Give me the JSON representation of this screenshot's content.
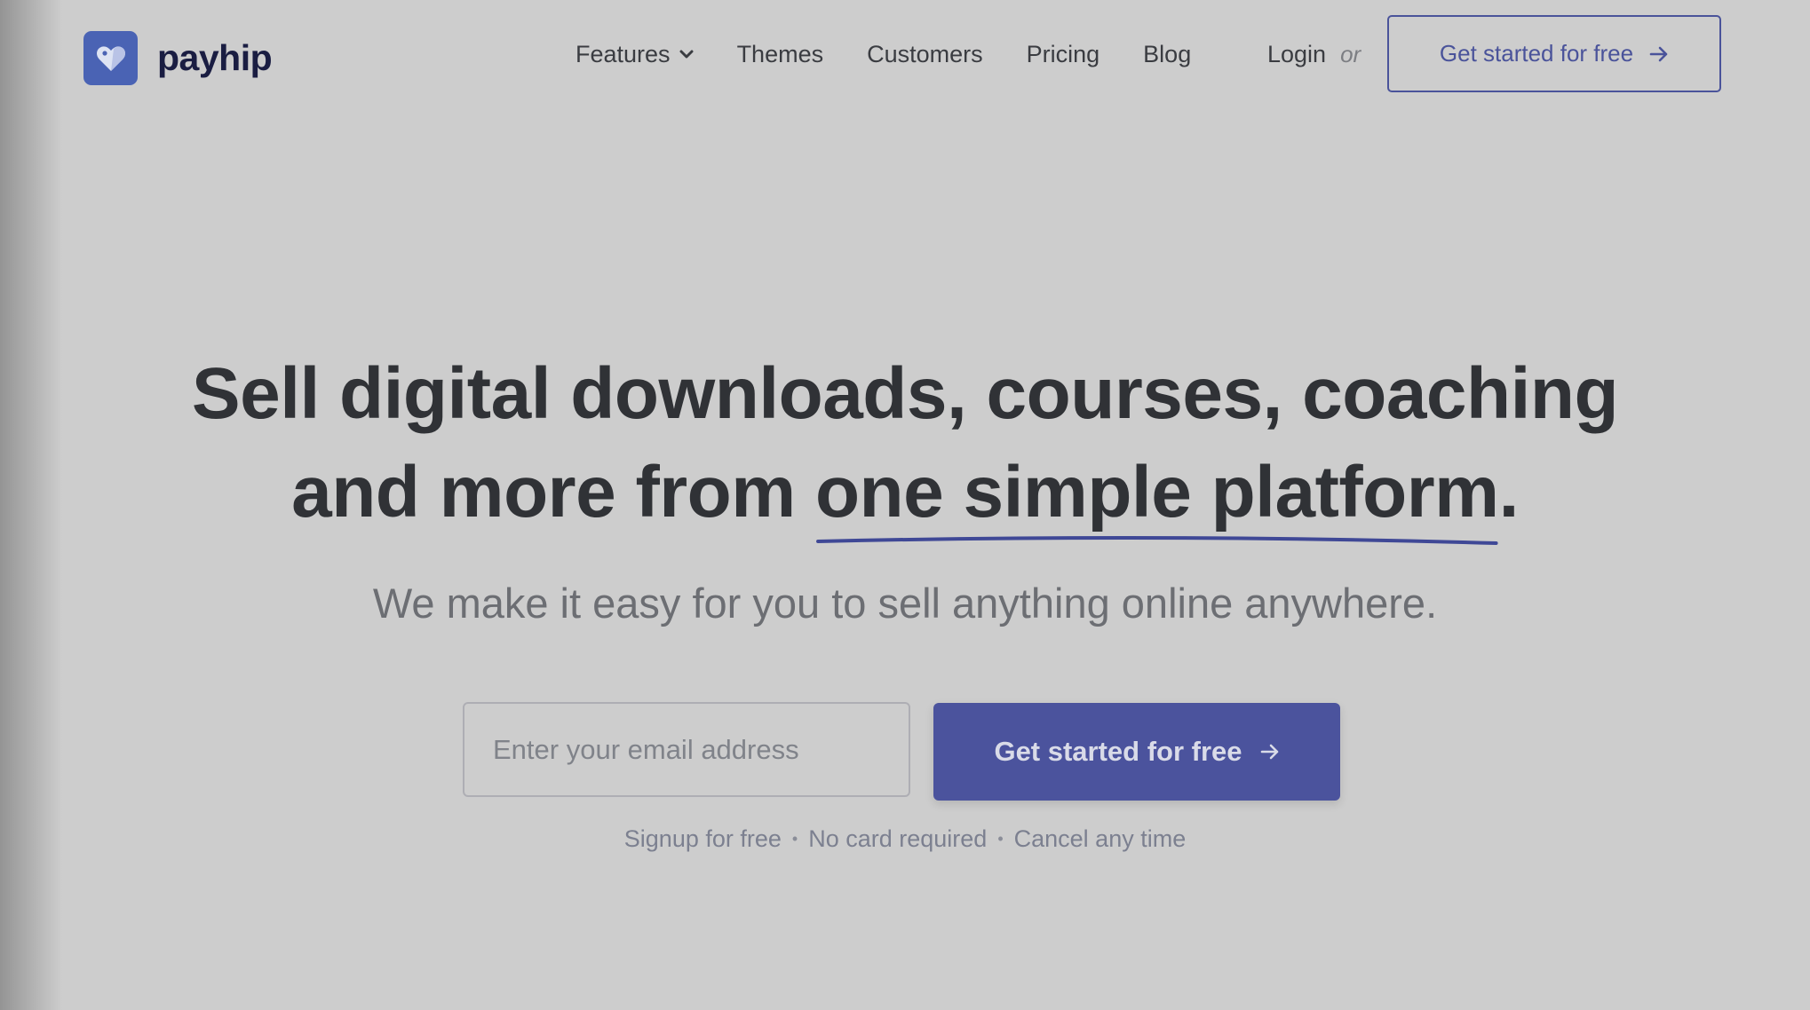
{
  "brand": {
    "name": "payhip",
    "icon": "heart-tag-icon",
    "accent": "#4b539d"
  },
  "nav": {
    "items": [
      {
        "label": "Features",
        "has_dropdown": true
      },
      {
        "label": "Themes"
      },
      {
        "label": "Customers"
      },
      {
        "label": "Pricing"
      },
      {
        "label": "Blog"
      }
    ],
    "login_label": "Login",
    "or_label": "or",
    "cta_label": "Get started for free"
  },
  "hero": {
    "title_line1": "Sell digital downloads, courses, coaching",
    "title_line2_prefix": "and more from ",
    "title_line2_highlight": "one simple platform",
    "title_line2_suffix": ".",
    "subtitle": "We make it easy for you to sell anything online anywhere.",
    "email_placeholder": "Enter your email address",
    "cta_label": "Get started for free",
    "reassurances": [
      "Signup for free",
      "No card required",
      "Cancel any time"
    ]
  }
}
